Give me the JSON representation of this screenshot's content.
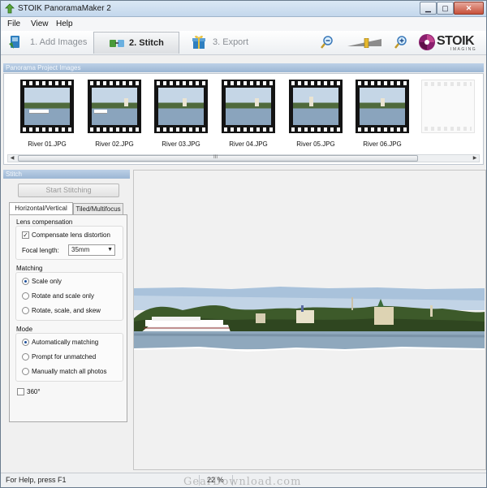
{
  "window": {
    "title": "STOIK PanoramaMaker 2"
  },
  "menu": [
    "File",
    "View",
    "Help"
  ],
  "toolbar": {
    "steps": [
      {
        "label": "1. Add Images",
        "active": false
      },
      {
        "label": "2. Stitch",
        "active": true
      },
      {
        "label": "3. Export",
        "active": false
      }
    ],
    "logo": {
      "name": "STOIK",
      "sub": "IMAGING"
    }
  },
  "images_panel": {
    "title": "Panorama Project Images",
    "images": [
      "River 01.JPG",
      "River 02.JPG",
      "River 03.JPG",
      "River 04.JPG",
      "River 05.JPG",
      "River 06.JPG"
    ],
    "scroll_grip": "III"
  },
  "stitch_panel": {
    "title": "Stitch",
    "start_button": "Start Stitching",
    "tabs": [
      "Horizontal/Vertical",
      "Tiled/Multifocus"
    ],
    "lens": {
      "title": "Lens compensation",
      "compensate_label": "Compensate lens distortion",
      "compensate_checked": true,
      "focal_label": "Focal length:",
      "focal_value": "35mm"
    },
    "matching": {
      "title": "Matching",
      "options": [
        "Scale only",
        "Rotate and scale only",
        "Rotate, scale, and skew"
      ],
      "selected": 0
    },
    "mode": {
      "title": "Mode",
      "options": [
        "Automatically matching",
        "Prompt for unmatched",
        "Manually match all photos"
      ],
      "selected": 0
    },
    "three_sixty_label": "360°",
    "three_sixty_checked": false
  },
  "status": {
    "help": "For Help, press F1",
    "zoom": "22 %"
  },
  "watermark": "GearDownload.com",
  "colors": {
    "accent": "#9bb6d4",
    "logo": "#8a1f6e"
  }
}
